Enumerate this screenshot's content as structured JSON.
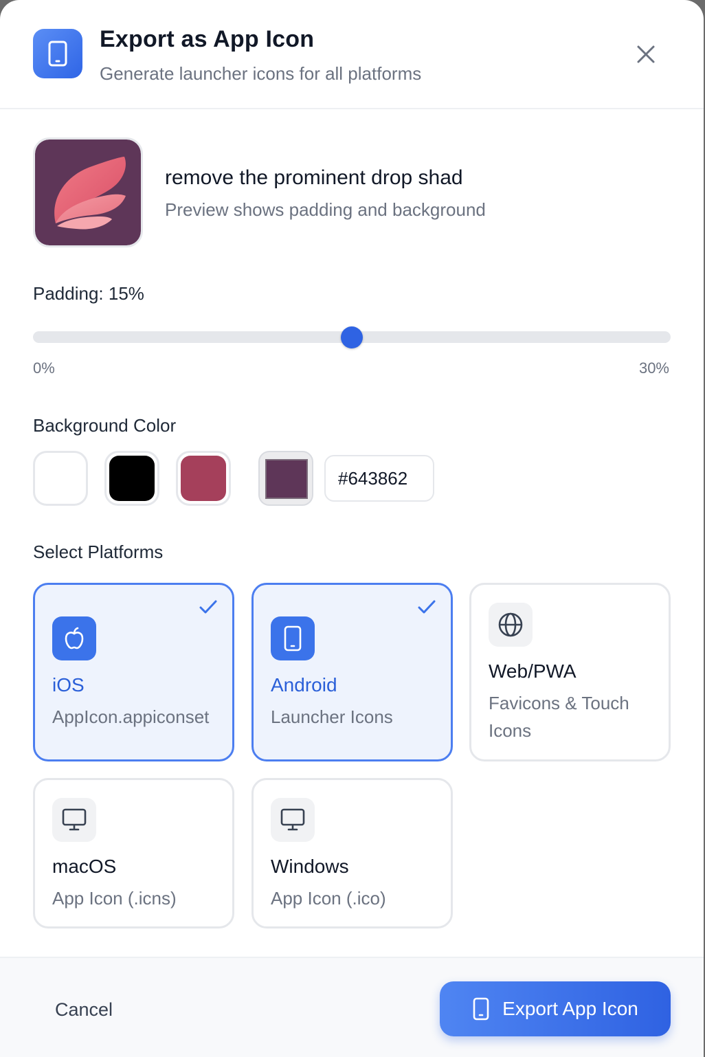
{
  "header": {
    "title": "Export as App Icon",
    "subtitle": "Generate launcher icons for all platforms",
    "icon": "phone-icon",
    "close_icon": "close-icon"
  },
  "preview": {
    "title": "remove the prominent drop shad",
    "subtitle": "Preview shows padding and background",
    "background": "#5e3658"
  },
  "padding": {
    "label": "Padding: 15%",
    "value_percent": 15,
    "min_percent": 0,
    "max_percent": 30,
    "min_label": "0%",
    "max_label": "30%"
  },
  "background_color": {
    "label": "Background Color",
    "swatches": [
      {
        "name": "white",
        "hex": "#ffffff"
      },
      {
        "name": "black",
        "hex": "#000000"
      },
      {
        "name": "rose",
        "hex": "#a5405b"
      }
    ],
    "custom_color": "#5e3658",
    "hex_value": "#643862"
  },
  "platforms": {
    "label": "Select Platforms",
    "items": [
      {
        "name": "iOS",
        "desc": "AppIcon.appiconset",
        "selected": true,
        "icon": "apple-icon"
      },
      {
        "name": "Android",
        "desc": "Launcher Icons",
        "selected": true,
        "icon": "phone-icon"
      },
      {
        "name": "Web/PWA",
        "desc_line1": "Favicons & Touch",
        "desc_line2": "Icons",
        "selected": false,
        "icon": "globe-icon"
      },
      {
        "name": "macOS",
        "desc": "App Icon (.icns)",
        "selected": false,
        "icon": "monitor-icon"
      },
      {
        "name": "Windows",
        "desc": "App Icon (.ico)",
        "selected": false,
        "icon": "monitor-icon"
      }
    ]
  },
  "footer": {
    "cancel_label": "Cancel",
    "export_label": "Export App Icon"
  },
  "colors": {
    "accent": "#2f63e3",
    "selected_border": "#4c7ef0",
    "selected_bg": "#eef3fd"
  }
}
